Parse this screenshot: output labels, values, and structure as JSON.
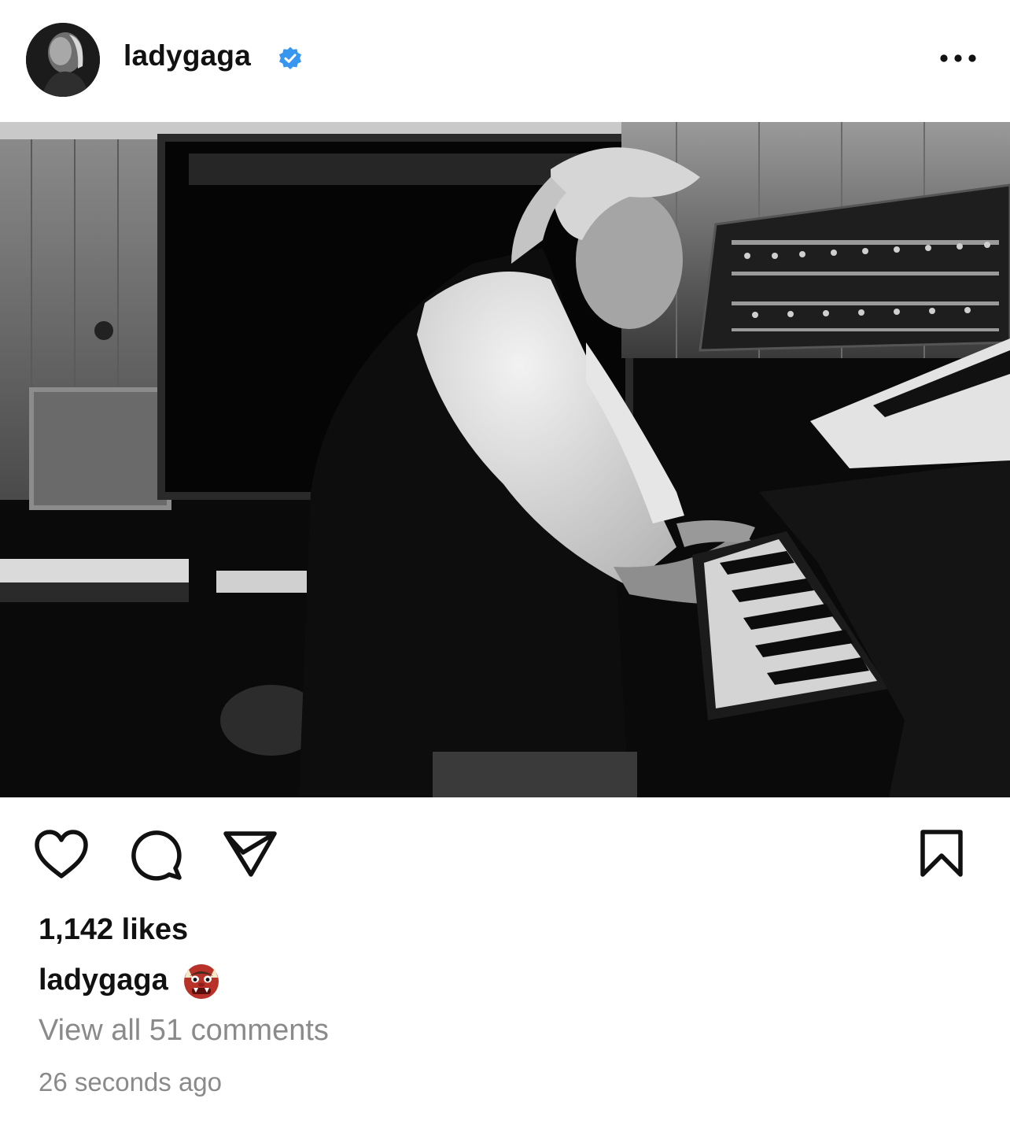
{
  "post": {
    "username": "ladygaga",
    "verified": true,
    "likes_text": "1,142 likes",
    "caption_user": "ladygaga",
    "caption_emoji": "ogre-emoji",
    "comments_link": "View all 51 comments",
    "timestamp": "26 seconds ago"
  },
  "icons": {
    "verified": "verified-badge-icon",
    "more": "more-options-icon",
    "like": "heart-icon",
    "comment": "comment-icon",
    "share": "send-icon",
    "save": "bookmark-icon"
  },
  "colors": {
    "verified_blue": "#3797f0",
    "text_primary": "#111111",
    "text_secondary": "#8a8a8a"
  }
}
